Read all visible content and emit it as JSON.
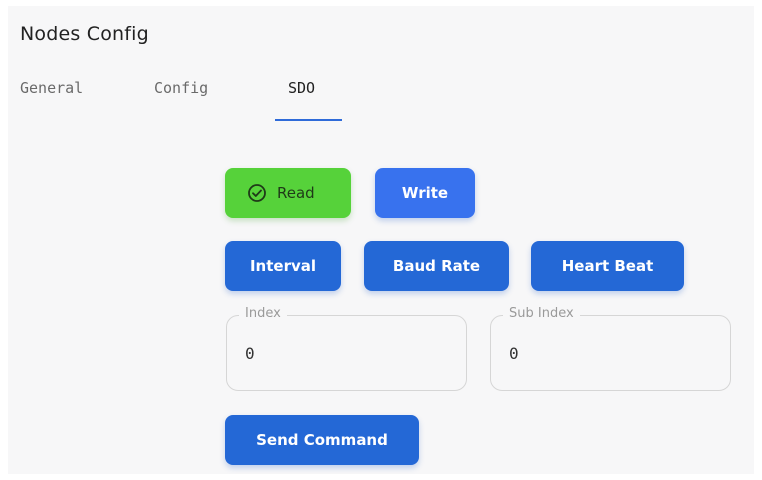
{
  "page": {
    "title": "Nodes Config"
  },
  "tabs": [
    {
      "label": "General",
      "active": false
    },
    {
      "label": "Config",
      "active": false
    },
    {
      "label": "SDO",
      "active": true
    }
  ],
  "sdo": {
    "read_label": "Read",
    "read_icon": "check-circle-icon",
    "write_label": "Write",
    "interval_label": "Interval",
    "baud_rate_label": "Baud Rate",
    "heart_beat_label": "Heart Beat",
    "index": {
      "label": "Index",
      "value": "0"
    },
    "sub_index": {
      "label": "Sub Index",
      "value": "0"
    },
    "send_command_label": "Send Command"
  },
  "colors": {
    "accent_blue": "#2468d6",
    "write_blue": "#3872ee",
    "read_green": "#56d23a",
    "tab_indicator": "#2f6bd9"
  }
}
